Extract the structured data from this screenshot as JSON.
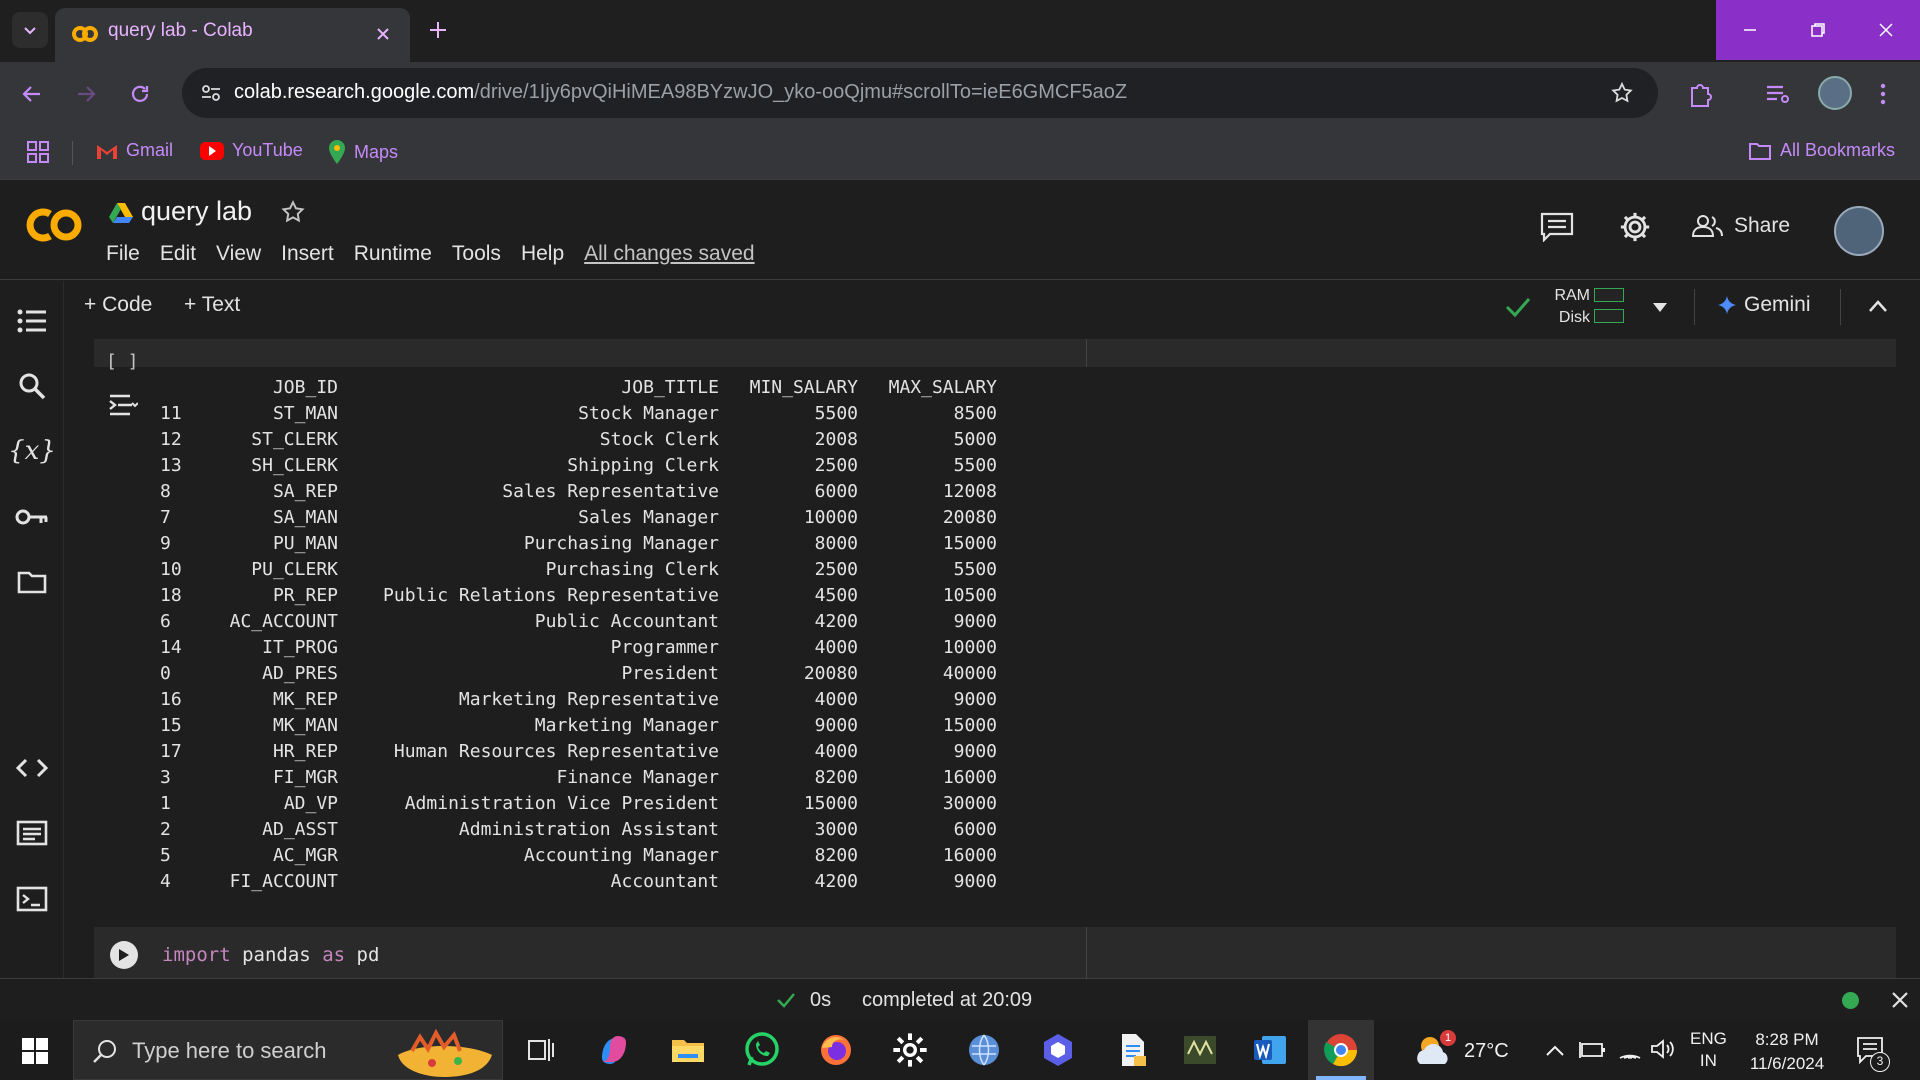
{
  "browser": {
    "tab_title": "query lab - Colab",
    "url_host": "colab.research.google.com",
    "url_path": "/drive/1Ijy6pvQiHiMEA98BYzwJO_yko-ooQjmu#scrollTo=ieE6GMCF5aoZ",
    "bookmarks": [
      "Gmail",
      "YouTube",
      "Maps"
    ],
    "all_bookmarks": "All Bookmarks"
  },
  "colab": {
    "notebook_title": "query lab",
    "menu": [
      "File",
      "Edit",
      "View",
      "Insert",
      "Runtime",
      "Tools",
      "Help"
    ],
    "saved_status": "All changes saved",
    "share_label": "Share",
    "add_code": "+ Code",
    "add_text": "+ Text",
    "ram_label": "RAM",
    "disk_label": "Disk",
    "gemini_label": "Gemini",
    "cell1_brackets": "[ ]"
  },
  "output_table": {
    "headers": [
      "",
      "JOB_ID",
      "JOB_TITLE",
      "MIN_SALARY",
      "MAX_SALARY"
    ],
    "rows": [
      [
        "11",
        "ST_MAN",
        "Stock Manager",
        "5500",
        "8500"
      ],
      [
        "12",
        "ST_CLERK",
        "Stock Clerk",
        "2008",
        "5000"
      ],
      [
        "13",
        "SH_CLERK",
        "Shipping Clerk",
        "2500",
        "5500"
      ],
      [
        "8",
        "SA_REP",
        "Sales Representative",
        "6000",
        "12008"
      ],
      [
        "7",
        "SA_MAN",
        "Sales Manager",
        "10000",
        "20080"
      ],
      [
        "9",
        "PU_MAN",
        "Purchasing Manager",
        "8000",
        "15000"
      ],
      [
        "10",
        "PU_CLERK",
        "Purchasing Clerk",
        "2500",
        "5500"
      ],
      [
        "18",
        "PR_REP",
        "Public Relations Representative",
        "4500",
        "10500"
      ],
      [
        "6",
        "AC_ACCOUNT",
        "Public Accountant",
        "4200",
        "9000"
      ],
      [
        "14",
        "IT_PROG",
        "Programmer",
        "4000",
        "10000"
      ],
      [
        "0",
        "AD_PRES",
        "President",
        "20080",
        "40000"
      ],
      [
        "16",
        "MK_REP",
        "Marketing Representative",
        "4000",
        "9000"
      ],
      [
        "15",
        "MK_MAN",
        "Marketing Manager",
        "9000",
        "15000"
      ],
      [
        "17",
        "HR_REP",
        "Human Resources Representative",
        "4000",
        "9000"
      ],
      [
        "3",
        "FI_MGR",
        "Finance Manager",
        "8200",
        "16000"
      ],
      [
        "1",
        "AD_VP",
        "Administration Vice President",
        "15000",
        "30000"
      ],
      [
        "2",
        "AD_ASST",
        "Administration Assistant",
        "3000",
        "6000"
      ],
      [
        "5",
        "AC_MGR",
        "Accounting Manager",
        "8200",
        "16000"
      ],
      [
        "4",
        "FI_ACCOUNT",
        "Accountant",
        "4200",
        "9000"
      ]
    ]
  },
  "code_cell": {
    "kw1": "import",
    "mod": "pandas",
    "kw2": "as",
    "alias": "pd"
  },
  "status": {
    "elapsed": "0s",
    "completed": "completed at 20:09"
  },
  "taskbar": {
    "search_placeholder": "Type here to search",
    "weather": "27°C",
    "lang_top": "ENG",
    "lang_bottom": "IN",
    "time": "8:28 PM",
    "date": "11/6/2024",
    "notif_count": "3",
    "weather_badge": "1"
  },
  "colors": {
    "accent_purple": "#8b2fc9",
    "colab_orange": "#f9ab00",
    "ok_green": "#34a853"
  }
}
